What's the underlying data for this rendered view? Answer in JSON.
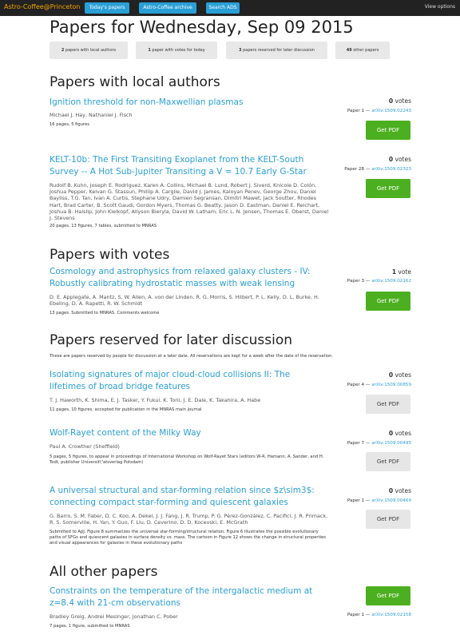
{
  "nav": {
    "brand": "Astro-Coffee@Princeton",
    "buttons": [
      "Today's papers",
      "Astro-Coffee archive",
      "Search ADS"
    ],
    "view_options": "View options"
  },
  "page_title": "Papers for Wednesday, Sep 09 2015",
  "summary": [
    {
      "count": "2",
      "text": " papers with local authors"
    },
    {
      "count": "1",
      "text": " paper with votes for today"
    },
    {
      "count": "3",
      "text": " papers reserved for later discussion"
    },
    {
      "count": "49",
      "text": " other papers"
    }
  ],
  "sections": {
    "local": "Papers with local authors",
    "votes": "Papers with votes",
    "reserved": "Papers reserved for later discussion",
    "reserved_desc": "These are papers reserved by people for discussion at a later date. All reservations are kept for a week after the date of the reservation.",
    "other": "All other papers"
  },
  "papers": [
    {
      "title": "Ignition threshold for non-Maxwellian plasmas",
      "authors": "Michael J. Hay, Nathaniel J. Fisch",
      "comment": "16 pages, 5 figures",
      "votes": "0",
      "votes_word": " votes",
      "paper_no": "Paper 1 — ",
      "arxiv": "arXiv:1509.02243",
      "button": "Get PDF"
    },
    {
      "title": "KELT-10b: The First Transiting Exoplanet from the KELT-South Survey -- A Hot Sub-Jupiter Transiting a V = 10.7 Early G-Star",
      "authors": "Rudolf B. Kuhn, Joseph E. Rodriguez, Karen A. Collins, Michael B. Lund, Robert J. Siverd, Knicole D. Colón, Joshua Pepper, Keivan G. Stassun, Phillip A. Cargile, David J. James, Kaloyan Penev, George Zhou, Daniel Bayliss, T.G. Tan, Ivan A. Curtis, Stephane Udry, Damien Segransan, Dimitri Mawet, Jack Soutter, Rhodes Hart, Brad Carter, B. Scott Gaudi, Gordon Myers, Thomas G. Beatty, Jason D. Eastman, Daniel E. Reichart, Joshua B. Haislip, John Kielkopf, Allyson Bieryla, David W. Latham, Eric L. N. Jensen, Thomas E. Oberst, Daniel J. Stevens",
      "comment": "20 pages, 13 figures, 7 tables, submitted to MNRAS",
      "votes": "0",
      "votes_word": " votes",
      "paper_no": "Paper 28 — ",
      "arxiv": "arXiv:1509.02323",
      "button": "Get PDF"
    },
    {
      "title": "Cosmology and astrophysics from relaxed galaxy clusters - IV: Robustly calibrating hydrostatic masses with weak lensing",
      "authors": "D. E. Applegate, A. Mantz, S. W. Allen, A. von der Linden, R. G. Morris, S. Hilbert, P. L. Kelly, D. L. Burke, H. Ebeling, D. A. Rapetti, R. W. Schmidt",
      "comment": "13 pages. Submitted to MNRAS. Comments welcome",
      "votes": "1",
      "votes_word": " vote",
      "paper_no": "Paper 3 — ",
      "arxiv": "arXiv:1509.02162",
      "button": "Get PDF"
    },
    {
      "title": "Isolating signatures of major cloud-cloud collisions II: The lifetimes of broad bridge features",
      "authors": "T. J. Haworth, K. Shima, E. J. Tasker, Y. Fukui, K. Torii, J. E. Dale, K. Takahira, A. Habe",
      "comment": "11 pages, 10 figures, accepted for publication in the MNRAS main journal",
      "votes": "0",
      "votes_word": " votes",
      "paper_no": "Paper 4 — ",
      "arxiv": "arXiv:1509.00859",
      "button": "Get PDF"
    },
    {
      "title": "Wolf-Rayet content of the Milky Way",
      "authors": "Paul A. Crowther (Sheffield)",
      "comment": "5 pages, 5 figures, to appear in proceedings of International Workshop on Wolf-Rayet Stars (editors W-R. Hamann, A. Sander, and H. Todt, publisher Universit\\\"atsverlag Potsdam)",
      "votes": "0",
      "votes_word": " votes",
      "paper_no": "Paper 7 — ",
      "arxiv": "arXiv:1509.00495",
      "button": "Get PDF"
    },
    {
      "title": "A universal structural and star-forming relation since $z\\sim3$: connecting compact star-forming and quiescent galaxies",
      "authors": "G. Barro, S. M. Faber, D. C. Koo, A. Dekel, J. J. Fang, J. R. Trump, P. G. Pérez-González, C. Pacifici, J. R. Primack, R. S. Somerville, H. Yan, Y. Guo, F. Liu, D. Ceverino, D. D. Kocevski, E. McGrath",
      "comment": "Submitted to ApJ. Figure 8 summarizes the universal star-forming/structural relation. Figure 6 illustrates the possible evolutionary paths of SFGs and quiescent galaxies in surface density vs. mass. The cartoon in Figure 12 shows the change in structural properties and visual appearances for galaxies in these evolutionary paths",
      "votes": "0",
      "votes_word": " votes",
      "paper_no": "Paper 1 — ",
      "arxiv": "arXiv:1509.00469",
      "button": "Get PDF"
    },
    {
      "title": "Constraints on the temperature of the intergalactic medium at z=8.4 with 21-cm observations",
      "authors": "Bradley Greig, Andrei Mesinger, Jonathan C. Pober",
      "comment": "7 pages, 1 figure, submitted to MNRAS",
      "paper_no": "Paper 1 — ",
      "arxiv": "arXiv:1509.02158",
      "button": "Get PDF"
    }
  ]
}
